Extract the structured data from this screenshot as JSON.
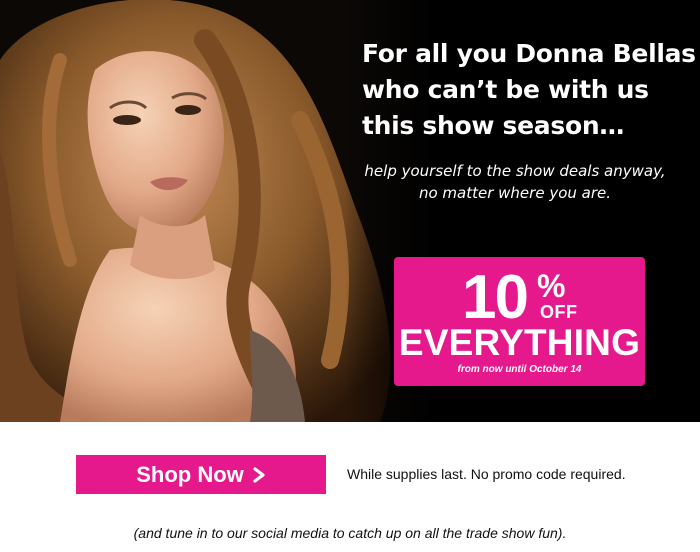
{
  "hero": {
    "headline_lines": [
      "For all you Donna Bellas",
      "who can’t be with us",
      "this show season…"
    ],
    "subtext_lines": [
      "help yourself to the show deals anyway,",
      "no matter where you are."
    ],
    "photo_icon": "woman-portrait-photo"
  },
  "promo": {
    "number": "10",
    "percent_sign": "%",
    "off": "OFF",
    "everything": "EVERYTHING",
    "until": "from now until October 14"
  },
  "cta": {
    "shop_label": "Shop Now",
    "chevron_icon": "chevron-right-icon",
    "note": "While supplies last. No promo code required."
  },
  "footer": {
    "social_note": "(and tune in to our social media to catch up on all the trade show fun)."
  },
  "colors": {
    "accent": "#e5198c",
    "hero_bg": "#000000",
    "page_bg": "#ffffff",
    "hair": "#8a5a2b",
    "skin": "#e9b696"
  }
}
